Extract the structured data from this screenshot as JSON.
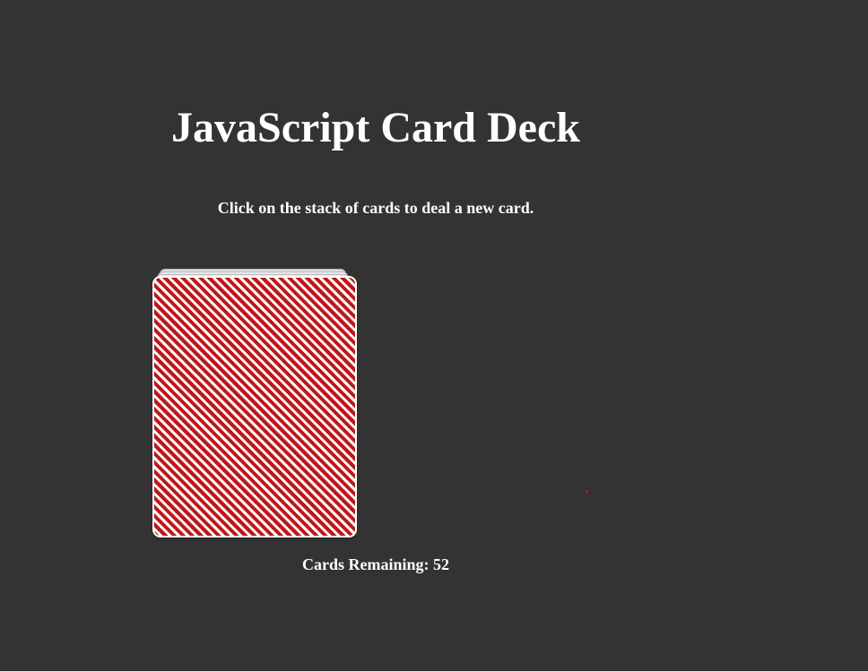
{
  "title": "JavaScript Card Deck",
  "instructions": "Click on the stack of cards to deal a new card.",
  "remaining": {
    "label": "Cards Remaining:",
    "count": 52
  },
  "colors": {
    "background": "#333333",
    "card_back_red": "#c0171a",
    "text": "#ffffff"
  }
}
